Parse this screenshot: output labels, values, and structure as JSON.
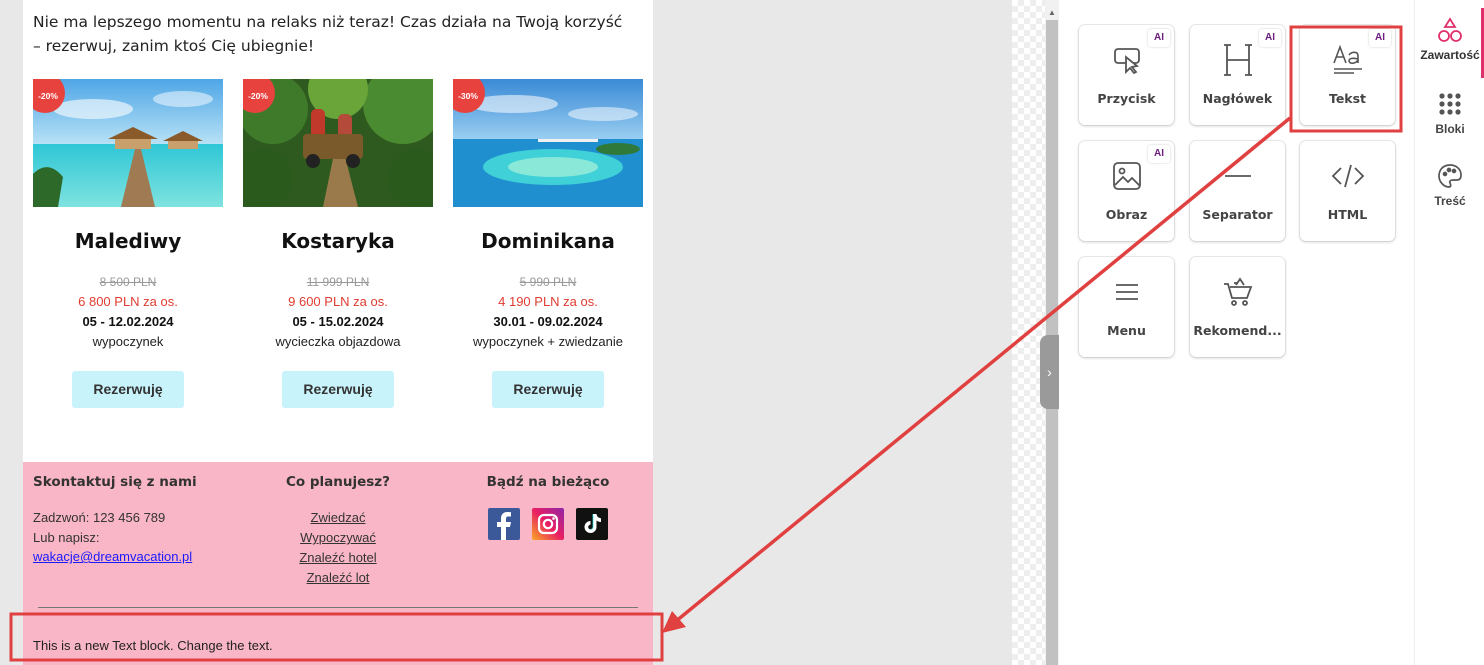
{
  "email": {
    "intro": "Nie ma lepszego momentu na relaks niż teraz! Czas działa na Twoją korzyść – rezerwuj, zanim ktoś Cię ubiegnie!",
    "offers": [
      {
        "badge": "-20%",
        "name": "Malediwy",
        "old_price": "8 500 PLN",
        "new_price": "6 800 PLN za os.",
        "dates": "05 - 12.02.2024",
        "kind": "wypoczynek",
        "button": "Rezerwuję"
      },
      {
        "badge": "-20%",
        "name": "Kostaryka",
        "old_price": "11 999 PLN",
        "new_price": "9 600 PLN za os.",
        "dates": "05 - 15.02.2024",
        "kind": "wycieczka objazdowa",
        "button": "Rezerwuję"
      },
      {
        "badge": "-30%",
        "name": "Dominikana",
        "old_price": "5 990 PLN",
        "new_price": "4 190 PLN za os.",
        "dates": "30.01 - 09.02.2024",
        "kind": "wypoczynek + zwiedzanie",
        "button": "Rezerwuję"
      }
    ],
    "footer": {
      "contact_title": "Skontaktuj się z nami",
      "phone": "Zadzwoń: 123 456 789",
      "write": "Lub napisz:",
      "email": "wakacje@dreamvacation.pl",
      "plans_title": "Co planujesz?",
      "plans": [
        "Zwiedzać",
        "Wypoczywać",
        "Znaleźć hotel",
        "Znaleźć lot"
      ],
      "social_title": "Bądź na bieżąco",
      "new_text": "This is a new Text block. Change the text."
    }
  },
  "panel": {
    "tiles": [
      {
        "label": "Przycisk",
        "ai": "AI",
        "icon": "button-cursor-icon"
      },
      {
        "label": "Nagłówek",
        "ai": "AI",
        "icon": "heading-icon"
      },
      {
        "label": "Tekst",
        "ai": "AI",
        "icon": "text-icon"
      },
      {
        "label": "Obraz",
        "ai": "AI",
        "icon": "image-icon"
      },
      {
        "label": "Separator",
        "icon": "separator-icon"
      },
      {
        "label": "HTML",
        "icon": "code-icon"
      },
      {
        "label": "Menu",
        "icon": "menu-icon"
      },
      {
        "label": "Rekomend...",
        "icon": "cart-icon"
      }
    ]
  },
  "sidenav": {
    "items": [
      {
        "label": "Zawartość",
        "icon": "shapes-icon"
      },
      {
        "label": "Bloki",
        "icon": "grid-icon"
      },
      {
        "label": "Treść",
        "icon": "palette-icon"
      }
    ]
  },
  "colors": {
    "accent": "#e0306b",
    "annotation": "#e04040",
    "footer_bg": "#f9b6c6",
    "button_bg": "#c9f3fb",
    "price_red": "#e03c31"
  }
}
